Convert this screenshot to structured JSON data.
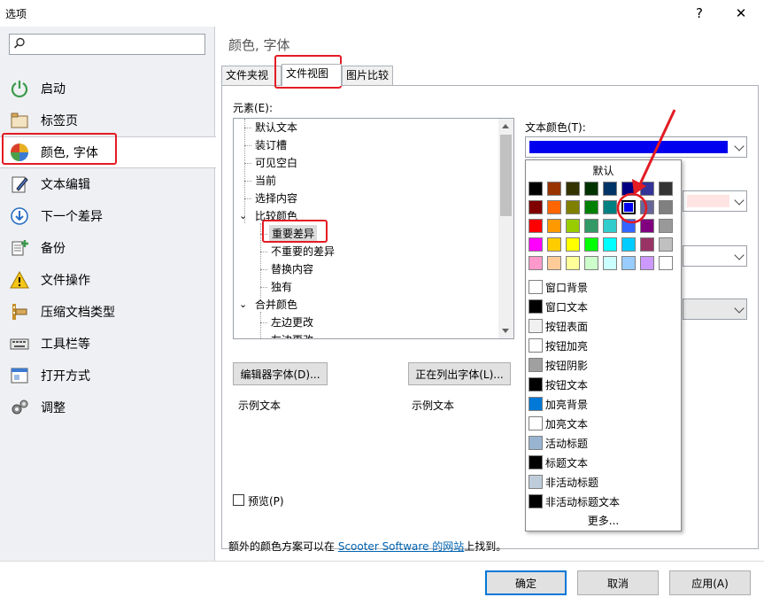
{
  "window": {
    "title": "选项",
    "help": "?",
    "close": "✕"
  },
  "sidebar": {
    "search_placeholder": "",
    "items": [
      {
        "label": "启动",
        "icon": "power-icon"
      },
      {
        "label": "标签页",
        "icon": "tabs-icon"
      },
      {
        "label": "颜色, 字体",
        "icon": "palette-icon"
      },
      {
        "label": "文本编辑",
        "icon": "edit-icon"
      },
      {
        "label": "下一个差异",
        "icon": "next-diff-icon"
      },
      {
        "label": "备份",
        "icon": "backup-icon"
      },
      {
        "label": "文件操作",
        "icon": "warning-icon"
      },
      {
        "label": "压缩文档类型",
        "icon": "archive-icon"
      },
      {
        "label": "工具栏等",
        "icon": "keyboard-icon"
      },
      {
        "label": "打开方式",
        "icon": "open-with-icon"
      },
      {
        "label": "调整",
        "icon": "gears-icon"
      }
    ],
    "selected_index": 2
  },
  "main": {
    "title": "颜色, 字体",
    "tabs": [
      "文件夹视图",
      "文件视图",
      "图片比较"
    ],
    "active_tab": 1,
    "elements_label": "元素(E):",
    "tree": [
      {
        "label": "默认文本",
        "level": 0
      },
      {
        "label": "装订槽",
        "level": 0
      },
      {
        "label": "可见空白",
        "level": 0
      },
      {
        "label": "当前",
        "level": 0
      },
      {
        "label": "选择内容",
        "level": 0
      },
      {
        "label": "比较颜色",
        "level": 0,
        "expand": "⌄"
      },
      {
        "label": "重要差异",
        "level": 1,
        "selected": true
      },
      {
        "label": "不重要的差异",
        "level": 1
      },
      {
        "label": "替换内容",
        "level": 1
      },
      {
        "label": "独有",
        "level": 1
      },
      {
        "label": "合并颜色",
        "level": 0,
        "expand": "⌄"
      },
      {
        "label": "左边更改",
        "level": 1
      },
      {
        "label": "左边更改",
        "level": 1
      }
    ],
    "text_color_label": "文本颜色(T):",
    "text_color_value": "#0000ee",
    "editor_font_button": "编辑器字体(D)...",
    "listing_font_button": "正在列出字体(L)...",
    "sample_text_1": "示例文本",
    "sample_text_2": "示例文本",
    "preview_label": "预览(P)",
    "footer_prefix": "额外的颜色方案可以在 ",
    "footer_link": "Scooter Software 的网站",
    "footer_suffix": "上找到。"
  },
  "color_popup": {
    "default_label": "默认",
    "grid": [
      [
        "#000000",
        "#993300",
        "#333300",
        "#003300",
        "#003366",
        "#000080",
        "#333399",
        "#333333"
      ],
      [
        "#800000",
        "#ff6600",
        "#808000",
        "#008000",
        "#008080",
        "#0000ee",
        "#666699",
        "#808080"
      ],
      [
        "#ff0000",
        "#ff9900",
        "#99cc00",
        "#339966",
        "#33cccc",
        "#3366ff",
        "#800080",
        "#999999"
      ],
      [
        "#ff00ff",
        "#ffcc00",
        "#ffff00",
        "#00ff00",
        "#00ffff",
        "#00ccff",
        "#993366",
        "#c0c0c0"
      ],
      [
        "#ff99cc",
        "#ffcc99",
        "#ffff99",
        "#ccffcc",
        "#ccffff",
        "#99ccff",
        "#cc99ff",
        "#ffffff"
      ]
    ],
    "selected_swatch": [
      1,
      5
    ],
    "system_colors": [
      {
        "label": "窗口背景",
        "color": "#ffffff"
      },
      {
        "label": "窗口文本",
        "color": "#000000"
      },
      {
        "label": "按钮表面",
        "color": "#f0f0f0"
      },
      {
        "label": "按钮加亮",
        "color": "#ffffff"
      },
      {
        "label": "按钮阴影",
        "color": "#a0a0a0"
      },
      {
        "label": "按钮文本",
        "color": "#000000"
      },
      {
        "label": "加亮背景",
        "color": "#0078d7"
      },
      {
        "label": "加亮文本",
        "color": "#ffffff"
      },
      {
        "label": "活动标题",
        "color": "#99b4d1"
      },
      {
        "label": "标题文本",
        "color": "#000000"
      },
      {
        "label": "非活动标题",
        "color": "#bfcddb"
      },
      {
        "label": "非活动标题文本",
        "color": "#000000"
      }
    ],
    "more_label": "更多..."
  },
  "bottom_buttons": {
    "ok": "确定",
    "cancel": "取消",
    "apply": "应用(A)"
  },
  "colors": {
    "accent": "#0078d7",
    "annotation_red": "#e31b23"
  }
}
